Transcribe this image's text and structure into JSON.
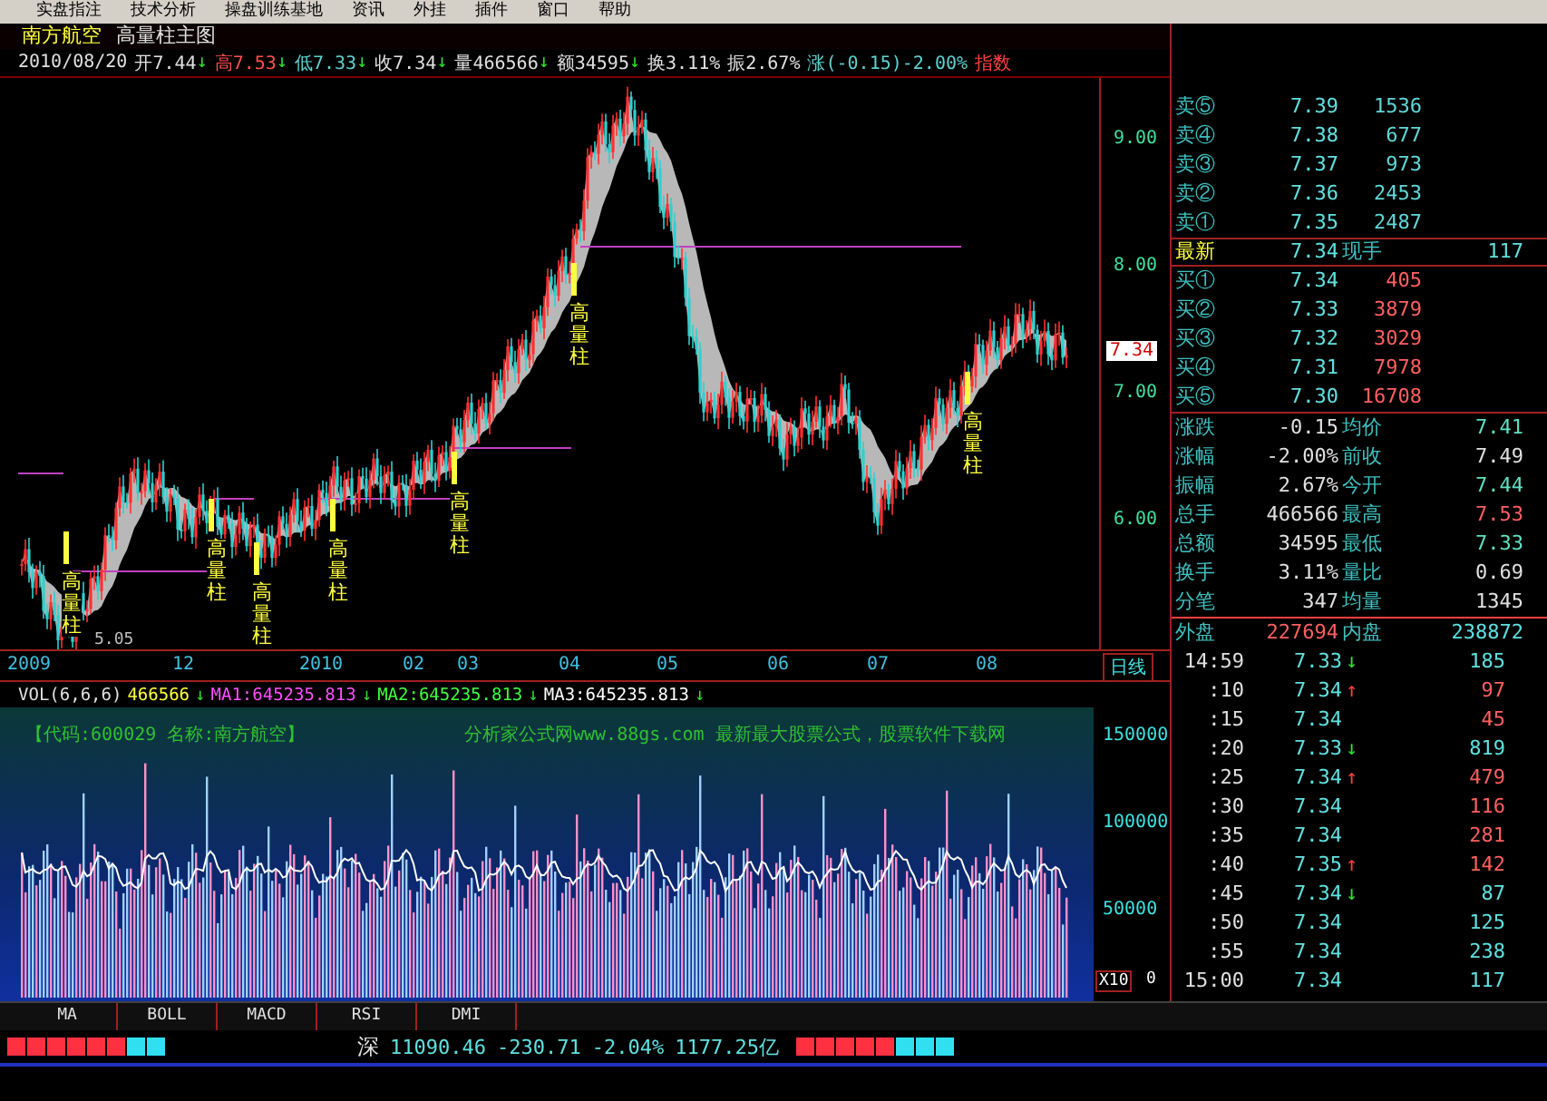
{
  "menu": [
    "实盘指注",
    "技术分析",
    "操盘训练基地",
    "资讯",
    "外挂",
    "插件",
    "窗口",
    "帮助"
  ],
  "chart_header": {
    "stock": "南方航空",
    "formula": "高量柱主图"
  },
  "quote_line": [
    {
      "kind": "date",
      "value": "2010/08/20",
      "color": "#e0e0e0"
    },
    {
      "kind": "field",
      "label": "开",
      "value": "7.44",
      "arrow": "↓",
      "color": "#e0e0e0"
    },
    {
      "kind": "field",
      "label": "高",
      "value": "7.53",
      "arrow": "↓",
      "color": "#ff5050"
    },
    {
      "kind": "field",
      "label": "低",
      "value": "7.33",
      "arrow": "↓",
      "color": "#60d0d0"
    },
    {
      "kind": "field",
      "label": "收",
      "value": "7.34",
      "arrow": "↓",
      "color": "#e0e0e0"
    },
    {
      "kind": "field",
      "label": "量",
      "value": "466566",
      "arrow": "↓",
      "color": "#e0e0e0"
    },
    {
      "kind": "field",
      "label": "额",
      "value": "34595",
      "arrow": "↓",
      "color": "#e0e0e0"
    },
    {
      "kind": "field",
      "label": "换",
      "value": "3.11%",
      "color": "#e0e0e0"
    },
    {
      "kind": "field",
      "label": "振",
      "value": "2.67%",
      "color": "#e0e0e0"
    },
    {
      "kind": "field",
      "label": "涨",
      "value": "(-0.15)-2.00%",
      "color": "#60d0d0"
    },
    {
      "kind": "tag",
      "value": "指数",
      "color": "#ff4040"
    }
  ],
  "price_axis": [
    "9.00",
    "8.00",
    "7.00",
    "6.00"
  ],
  "current_price_tag": "7.34",
  "low_marker": "5.05",
  "volume_markers": [
    "高量柱",
    "高量柱",
    "高量柱",
    "高量柱",
    "高量柱",
    "高量柱",
    "高量柱"
  ],
  "date_axis": [
    "2009",
    "12",
    "2010",
    "02",
    "03",
    "04",
    "05",
    "06",
    "07",
    "08"
  ],
  "period": "日线",
  "volume_header": {
    "title": "VOL(6,6,6)",
    "value": "466566",
    "arrow": "↓",
    "averages": [
      {
        "label": "MA1:645235.813",
        "arrow": "↓",
        "color": "#ff50ff"
      },
      {
        "label": "MA2:645235.813",
        "arrow": "↓",
        "color": "#40ff40"
      },
      {
        "label": "MA3:645235.813",
        "arrow": "↓",
        "color": "#ffffff"
      }
    ]
  },
  "volume_texts": [
    "【代码:600029 名称:南方航空】",
    "分析家公式网www.88gs.com 最新最大股票公式，股票软件下载网"
  ],
  "volume_axis": [
    "150000",
    "100000",
    "50000"
  ],
  "volume_scale": {
    "multiplier": "X10",
    "zero": "0"
  },
  "order_book": [
    {
      "kind": "sell",
      "label": "卖⑤",
      "price": "7.39",
      "volume": "1536"
    },
    {
      "kind": "sell",
      "label": "卖④",
      "price": "7.38",
      "volume": "677"
    },
    {
      "kind": "sell",
      "label": "卖③",
      "price": "7.37",
      "volume": "973"
    },
    {
      "kind": "sell",
      "label": "卖②",
      "price": "7.36",
      "volume": "2453"
    },
    {
      "kind": "sell",
      "label": "卖①",
      "price": "7.35",
      "volume": "2487"
    },
    {
      "kind": "latest",
      "label": "最新",
      "price": "7.34",
      "label2": "现手",
      "volume": "117"
    },
    {
      "kind": "buy",
      "label": "买①",
      "price": "7.34",
      "volume": "405"
    },
    {
      "kind": "buy",
      "label": "买②",
      "price": "7.33",
      "volume": "3879"
    },
    {
      "kind": "buy",
      "label": "买③",
      "price": "7.32",
      "volume": "3029"
    },
    {
      "kind": "buy",
      "label": "买④",
      "price": "7.31",
      "volume": "7978"
    },
    {
      "kind": "buy",
      "label": "买⑤",
      "price": "7.30",
      "volume": "16708"
    }
  ],
  "stats": [
    {
      "label": "涨跌",
      "value": "-0.15",
      "label2": "均价",
      "value2": "7.41",
      "color": "#60e0c0"
    },
    {
      "label": "涨幅",
      "value": "-2.00%",
      "label2": "前收",
      "value2": "7.49",
      "color": "#e0e0e0"
    },
    {
      "label": "振幅",
      "value": "2.67%",
      "label2": "今开",
      "value2": "7.44",
      "color": "#60e0c0"
    },
    {
      "label": "总手",
      "value": "466566",
      "label2": "最高",
      "value2": "7.53",
      "color": "#ff6060"
    },
    {
      "label": "总额",
      "value": "34595",
      "label2": "最低",
      "value2": "7.33",
      "color": "#60e0c0"
    },
    {
      "label": "换手",
      "value": "3.11%",
      "label2": "量比",
      "value2": "0.69",
      "color": "#e0e0e0"
    },
    {
      "label": "分笔",
      "value": "347",
      "label2": "均量",
      "value2": "1345",
      "color": "#e0e0e0"
    }
  ],
  "trade_side": {
    "outer_label": "外盘",
    "outer": "227694",
    "inner_label": "内盘",
    "inner": "238872"
  },
  "ticks": [
    {
      "time": "14:59",
      "price": "7.33",
      "arrow": "↓",
      "volume": "185",
      "color": "#60e0e0"
    },
    {
      "time": ":10",
      "price": "7.34",
      "arrow": "↑",
      "volume": "97",
      "color": "#ff6060"
    },
    {
      "time": ":15",
      "price": "7.34",
      "volume": "45",
      "color": "#ff6060"
    },
    {
      "time": ":20",
      "price": "7.33",
      "arrow": "↓",
      "volume": "819",
      "color": "#60e0e0"
    },
    {
      "time": ":25",
      "price": "7.34",
      "arrow": "↑",
      "volume": "479",
      "color": "#ff6060"
    },
    {
      "time": ":30",
      "price": "7.34",
      "volume": "116",
      "color": "#ff6060"
    },
    {
      "time": ":35",
      "price": "7.34",
      "volume": "281",
      "color": "#ff6060"
    },
    {
      "time": ":40",
      "price": "7.35",
      "arrow": "↑",
      "volume": "142",
      "color": "#ff6060"
    },
    {
      "time": ":45",
      "price": "7.34",
      "arrow": "↓",
      "volume": "87",
      "color": "#60e0e0"
    },
    {
      "time": ":50",
      "price": "7.34",
      "volume": "125",
      "color": "#60e0e0"
    },
    {
      "time": ":55",
      "price": "7.34",
      "volume": "238",
      "color": "#60e0e0"
    },
    {
      "time": "15:00",
      "price": "7.34",
      "volume": "117",
      "color": "#60e0e0"
    }
  ],
  "indicator_tabs": [
    {
      "label": "MA",
      "selected": false
    },
    {
      "label": "BOLL",
      "selected": false
    },
    {
      "label": "MACD",
      "selected": false
    },
    {
      "label": "RSI",
      "selected": false
    },
    {
      "label": "DMI",
      "selected": false
    }
  ],
  "status_bar": {
    "market": "深",
    "index": "11090.46",
    "change": "-230.71",
    "percent": "-2.04%",
    "turnover": "1177.25亿"
  }
}
